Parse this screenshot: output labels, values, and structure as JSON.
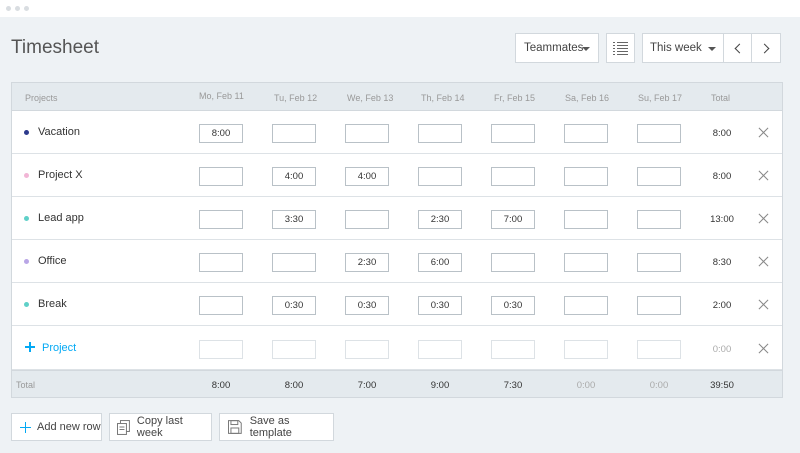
{
  "page": {
    "title": "Timesheet"
  },
  "toolbar": {
    "teammates_label": "Teammates",
    "period_label": "This week"
  },
  "table": {
    "project_col": "Projects",
    "days": [
      "Mo, Feb 11",
      "Tu, Feb 12",
      "We, Feb 13",
      "Th, Feb 14",
      "Fr, Feb 15",
      "Sa, Feb 16",
      "Su, Feb 17"
    ],
    "total_col": "Total",
    "rows": [
      {
        "project": "Vacation",
        "color": "#2d3a8c",
        "cells": [
          "8:00",
          "",
          "",
          "",
          "",
          "",
          ""
        ],
        "total": "8:00"
      },
      {
        "project": "Project X",
        "color": "#f2b6d6",
        "cells": [
          "",
          "4:00",
          "4:00",
          "",
          "",
          "",
          ""
        ],
        "total": "8:00"
      },
      {
        "project": "Lead app",
        "color": "#5fd0c8",
        "cells": [
          "",
          "3:30",
          "",
          "2:30",
          "7:00",
          "",
          ""
        ],
        "total": "13:00"
      },
      {
        "project": "Office",
        "color": "#b9a6e6",
        "cells": [
          "",
          "",
          "2:30",
          "6:00",
          "",
          "",
          ""
        ],
        "total": "8:30"
      },
      {
        "project": "Break",
        "color": "#5fd0c8",
        "cells": [
          "",
          "0:30",
          "0:30",
          "0:30",
          "0:30",
          "",
          ""
        ],
        "total": "2:00"
      }
    ],
    "new_row": {
      "label": "Project",
      "total": "0:00",
      "accent": "#03a9f4"
    },
    "footer": {
      "label": "Total",
      "values": [
        "8:00",
        "8:00",
        "7:00",
        "9:00",
        "7:30",
        "0:00",
        "0:00"
      ],
      "grand_total": "39:50"
    }
  },
  "actions": {
    "add_row": "Add new row",
    "copy_last_week": "Copy last week",
    "save_template": "Save as template"
  }
}
